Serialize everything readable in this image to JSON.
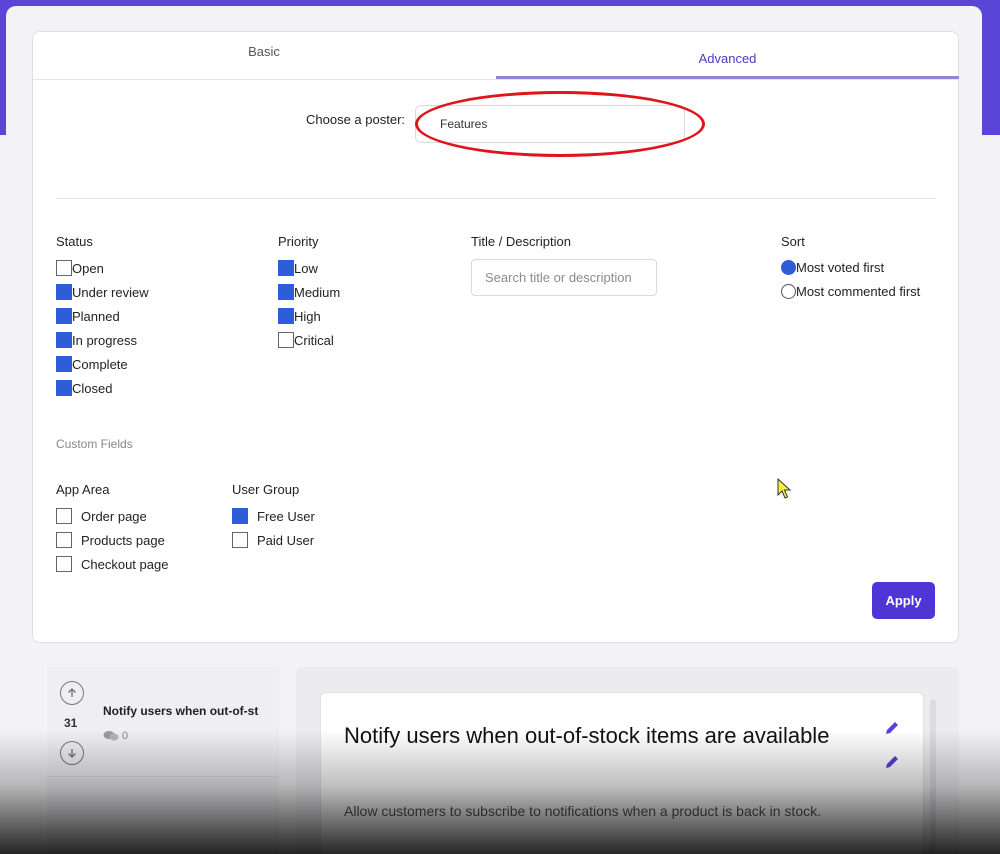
{
  "tabs": [
    {
      "label": "Basic"
    },
    {
      "label": "Advanced"
    }
  ],
  "poster": {
    "label": "Choose a poster:",
    "value": "Features"
  },
  "status": {
    "title": "Status",
    "options": [
      {
        "label": "Open",
        "checked": false
      },
      {
        "label": "Under review",
        "checked": true
      },
      {
        "label": "Planned",
        "checked": true
      },
      {
        "label": "In progress",
        "checked": true
      },
      {
        "label": "Complete",
        "checked": true
      },
      {
        "label": "Closed",
        "checked": true
      }
    ]
  },
  "priority": {
    "title": "Priority",
    "options": [
      {
        "label": "Low",
        "checked": true
      },
      {
        "label": "Medium",
        "checked": true
      },
      {
        "label": "High",
        "checked": true
      },
      {
        "label": "Critical",
        "checked": false
      }
    ]
  },
  "title_search": {
    "title": "Title / Description",
    "placeholder": "Search title or description"
  },
  "sort": {
    "title": "Sort",
    "options": [
      {
        "label": "Most voted first",
        "selected": true
      },
      {
        "label": "Most commented first",
        "selected": false
      }
    ]
  },
  "custom_fields": {
    "title": "Custom Fields"
  },
  "app_area": {
    "title": "App Area",
    "options": [
      {
        "label": "Order page",
        "checked": false
      },
      {
        "label": "Products page",
        "checked": false
      },
      {
        "label": "Checkout page",
        "checked": false
      }
    ]
  },
  "user_group": {
    "title": "User Group",
    "options": [
      {
        "label": "Free User",
        "checked": true
      },
      {
        "label": "Paid User",
        "checked": false
      }
    ]
  },
  "apply_label": "Apply",
  "post_list": [
    {
      "votes": "31",
      "title": "Notify users when out-of-st",
      "comments": "0"
    }
  ],
  "post_detail": {
    "title": "Notify users when out-of-stock items are available",
    "description": "Allow customers to subscribe to notifications when a product is back in stock."
  },
  "colors": {
    "accent": "#4f35d6",
    "checkbox_on": "#2f5cd8",
    "highlight": "#e0141a"
  }
}
